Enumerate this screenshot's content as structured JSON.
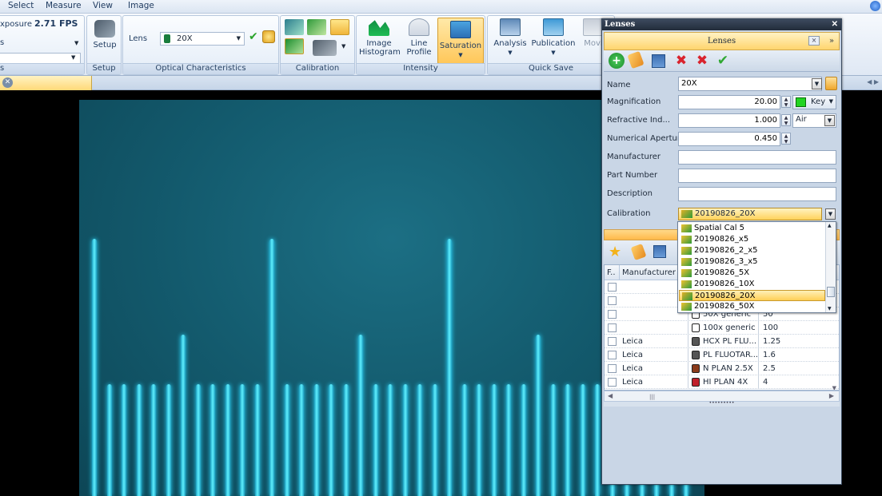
{
  "menu": {
    "select": "Select",
    "measure": "Measure",
    "view": "View",
    "image": "Image"
  },
  "ribbon": {
    "exposure": {
      "label": "xposure",
      "fps": "2.71 FPS",
      "row2": "s",
      "row3": "s"
    },
    "setup": {
      "button_label": "Setup",
      "group_label": "Setup"
    },
    "optical": {
      "lens_label": "Lens",
      "lens_value": "20X",
      "group_label": "Optical Characteristics"
    },
    "calibration": {
      "group_label": "Calibration"
    },
    "intensity": {
      "image_histogram_line1": "Image",
      "image_histogram_line2": "Histogram",
      "line_profile_line1": "Line",
      "line_profile_line2": "Profile",
      "saturation": "Saturation",
      "group_label": "Intensity"
    },
    "quick_save": {
      "analysis": "Analysis",
      "publication": "Publication",
      "movie": "Movi",
      "group_label": "Quick Save"
    }
  },
  "lenses_panel": {
    "window_title": "Lenses",
    "header_title": "Lenses",
    "close_glyph": "×",
    "collapse_glyph": "»",
    "form": {
      "name_label": "Name",
      "name_value": "20X",
      "magnification_label": "Magnification",
      "magnification_value": "20.00",
      "key_label": "Key",
      "refractive_label": "Refractive Ind...",
      "refractive_value": "1.000",
      "medium_value": "Air",
      "na_label": "Numerical Aperture",
      "na_value": "0.450",
      "manufacturer_label": "Manufacturer",
      "manufacturer_value": "",
      "part_number_label": "Part Number",
      "part_number_value": "",
      "description_label": "Description",
      "description_value": "",
      "calibration_label": "Calibration",
      "calibration_value": "20190826_20X"
    },
    "calibration_options": [
      "Spatial Cal 5",
      "20190826_x5",
      "20190826_2_x5",
      "20190826_3_x5",
      "20190826_5X",
      "20190826_10X",
      "20190826_20X",
      "20190826_50X"
    ],
    "selected_calibration": "20190826_20X",
    "grid": {
      "col_flag": "F..",
      "col_manufacturer": "Manufacturer",
      "rows": [
        {
          "manufacturer": "",
          "name": "50X generic",
          "magnification": "50"
        },
        {
          "manufacturer": "",
          "name": "100x generic",
          "magnification": "100"
        },
        {
          "manufacturer": "Leica",
          "name": "HCX PL FLU...",
          "magnification": "1.25"
        },
        {
          "manufacturer": "Leica",
          "name": "PL FLUOTAR...",
          "magnification": "1.6"
        },
        {
          "manufacturer": "Leica",
          "name": "N PLAN 2.5X",
          "magnification": "2.5"
        },
        {
          "manufacturer": "Leica",
          "name": "HI PLAN 4X",
          "magnification": "4"
        }
      ]
    }
  },
  "colors": {
    "ribbon_bg": "#dfe8f4",
    "accent_orange": "#ffd56e",
    "specimen_bg": "#135a6d",
    "graticule": "#5ff0ff",
    "key_color": "#22d422"
  }
}
